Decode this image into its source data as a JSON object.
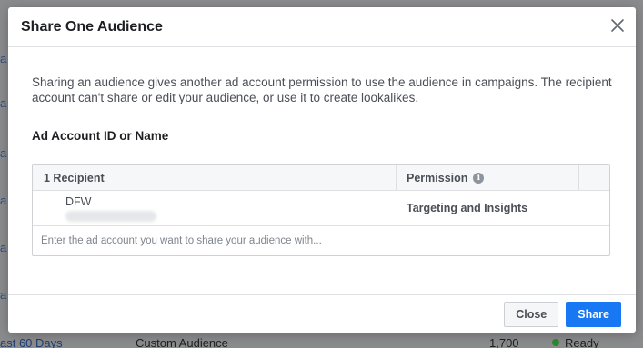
{
  "background": {
    "link_fragments": [
      "a",
      "a",
      "a",
      "a",
      "a",
      "a",
      "a"
    ],
    "bottom_row": {
      "time": "ast 60 Days",
      "type": "Custom Audience",
      "size": "1,700",
      "status": "Ready"
    }
  },
  "dialog": {
    "title": "Share One Audience",
    "intro": "Sharing an audience gives another ad account permission to use the audience in campaigns. The recipient account can't share or edit your audience, or use it to create lookalikes.",
    "account_label": "Ad Account ID or Name",
    "table": {
      "recipient_header": "1 Recipient",
      "permission_header": "Permission",
      "rows": [
        {
          "name": "DFW",
          "permission": "Targeting and Insights"
        }
      ],
      "input_placeholder": "Enter the ad account you want to share your audience with..."
    },
    "buttons": {
      "close": "Close",
      "share": "Share"
    }
  },
  "colors": {
    "primary": "#1877f2",
    "overlay": "#7f7f7f",
    "border": "#dddfe2"
  }
}
